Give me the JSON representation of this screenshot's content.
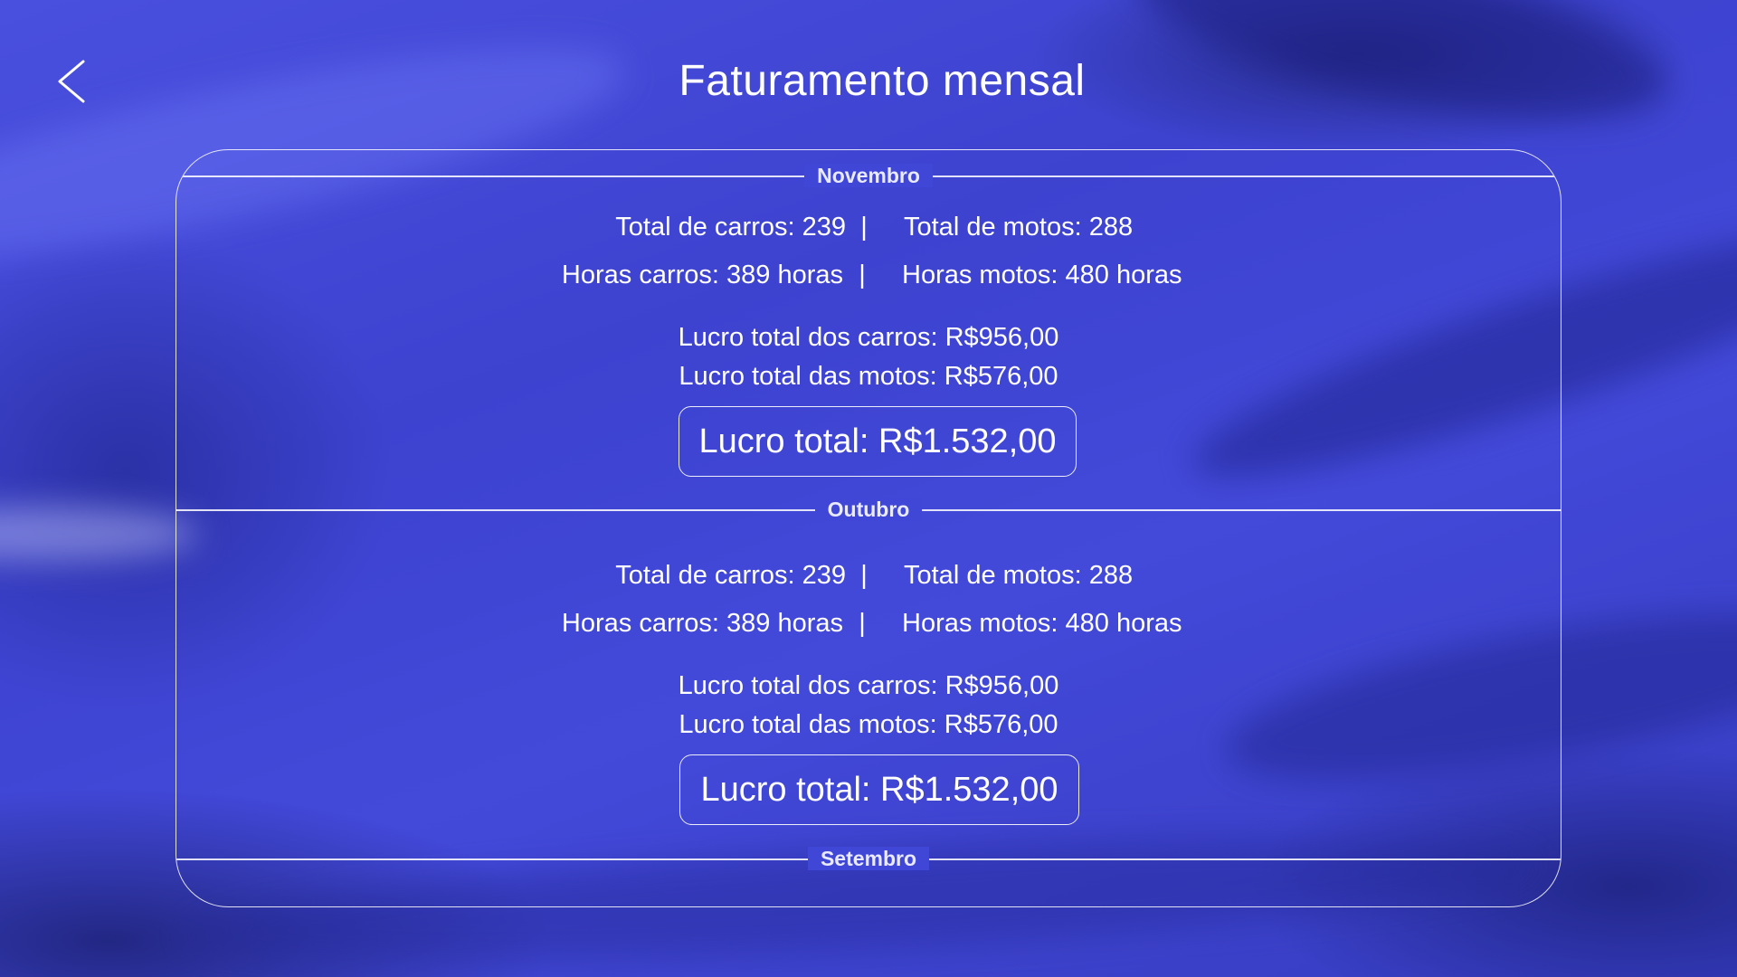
{
  "header": {
    "title": "Faturamento mensal",
    "back_icon": "chevron-left-icon"
  },
  "months": [
    {
      "name": "Novembro",
      "total_carros": "Total de carros: 239",
      "total_motos": "Total de motos: 288",
      "horas_carros": "Horas carros: 389 horas",
      "horas_motos": "Horas motos: 480 horas",
      "separator": "|",
      "lucro_carros": "Lucro total dos carros: R$956,00",
      "lucro_motos": "Lucro total das motos: R$576,00",
      "lucro_total": "Lucro total: R$1.532,00"
    },
    {
      "name": "Outubro",
      "total_carros": "Total de carros: 239",
      "total_motos": "Total de motos: 288",
      "horas_carros": "Horas carros: 389 horas",
      "horas_motos": "Horas motos: 480 horas",
      "separator": "|",
      "lucro_carros": "Lucro total dos carros: R$956,00",
      "lucro_motos": "Lucro total das motos: R$576,00",
      "lucro_total": "Lucro total: R$1.532,00"
    },
    {
      "name": "Setembro"
    }
  ],
  "colors": {
    "background": "#4047d6",
    "text": "#ffffff",
    "border": "#ffffff"
  }
}
